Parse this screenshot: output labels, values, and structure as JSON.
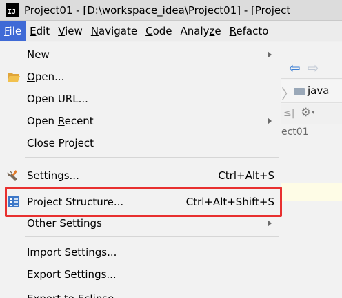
{
  "window": {
    "app_icon": "IJ",
    "title": "Project01 - [D:\\workspace_idea\\Project01] - [Project"
  },
  "menubar": {
    "items": [
      {
        "label": "File",
        "mnemonic": "F",
        "rest": "ile",
        "active": true
      },
      {
        "label": "Edit",
        "mnemonic": "E",
        "rest": "dit"
      },
      {
        "label": "View",
        "mnemonic": "V",
        "rest": "iew"
      },
      {
        "label": "Navigate",
        "mnemonic": "N",
        "rest": "avigate"
      },
      {
        "label": "Code",
        "mnemonic": "C",
        "rest": "ode"
      },
      {
        "label": "Analyze",
        "pre": "Analy",
        "mnemonic": "z",
        "rest": "e"
      },
      {
        "label": "Refacto",
        "mnemonic": "R",
        "rest": "efacto"
      }
    ]
  },
  "file_menu": {
    "new": {
      "label": "New"
    },
    "open": {
      "pre": "",
      "mnemonic": "O",
      "rest": "pen...",
      "icon": "folder-open-icon"
    },
    "open_url": {
      "label": "Open URL..."
    },
    "open_recent": {
      "pre": "Open ",
      "mnemonic": "R",
      "rest": "ecent"
    },
    "close_project": {
      "label": "Close Project"
    },
    "settings": {
      "pre": "Se",
      "mnemonic": "t",
      "rest": "tings...",
      "shortcut": "Ctrl+Alt+S",
      "icon": "settings-wrench-icon"
    },
    "project_structure": {
      "label": "Project Structure...",
      "shortcut": "Ctrl+Alt+Shift+S",
      "icon": "project-structure-icon"
    },
    "other_settings": {
      "label": "Other Settings"
    },
    "import_settings": {
      "label": "Import Settings..."
    },
    "export_settings": {
      "pre": "",
      "mnemonic": "E",
      "rest": "xport Settings..."
    },
    "export_to_eclipse": {
      "label": "Export to Eclipse..."
    }
  },
  "background": {
    "breadcrumb_text": "java",
    "project_tab_text": "ect01"
  },
  "colors": {
    "menu_active": "#3f6ad6",
    "highlight_border": "#e8302f",
    "menu_bg": "#f2f2f2"
  }
}
